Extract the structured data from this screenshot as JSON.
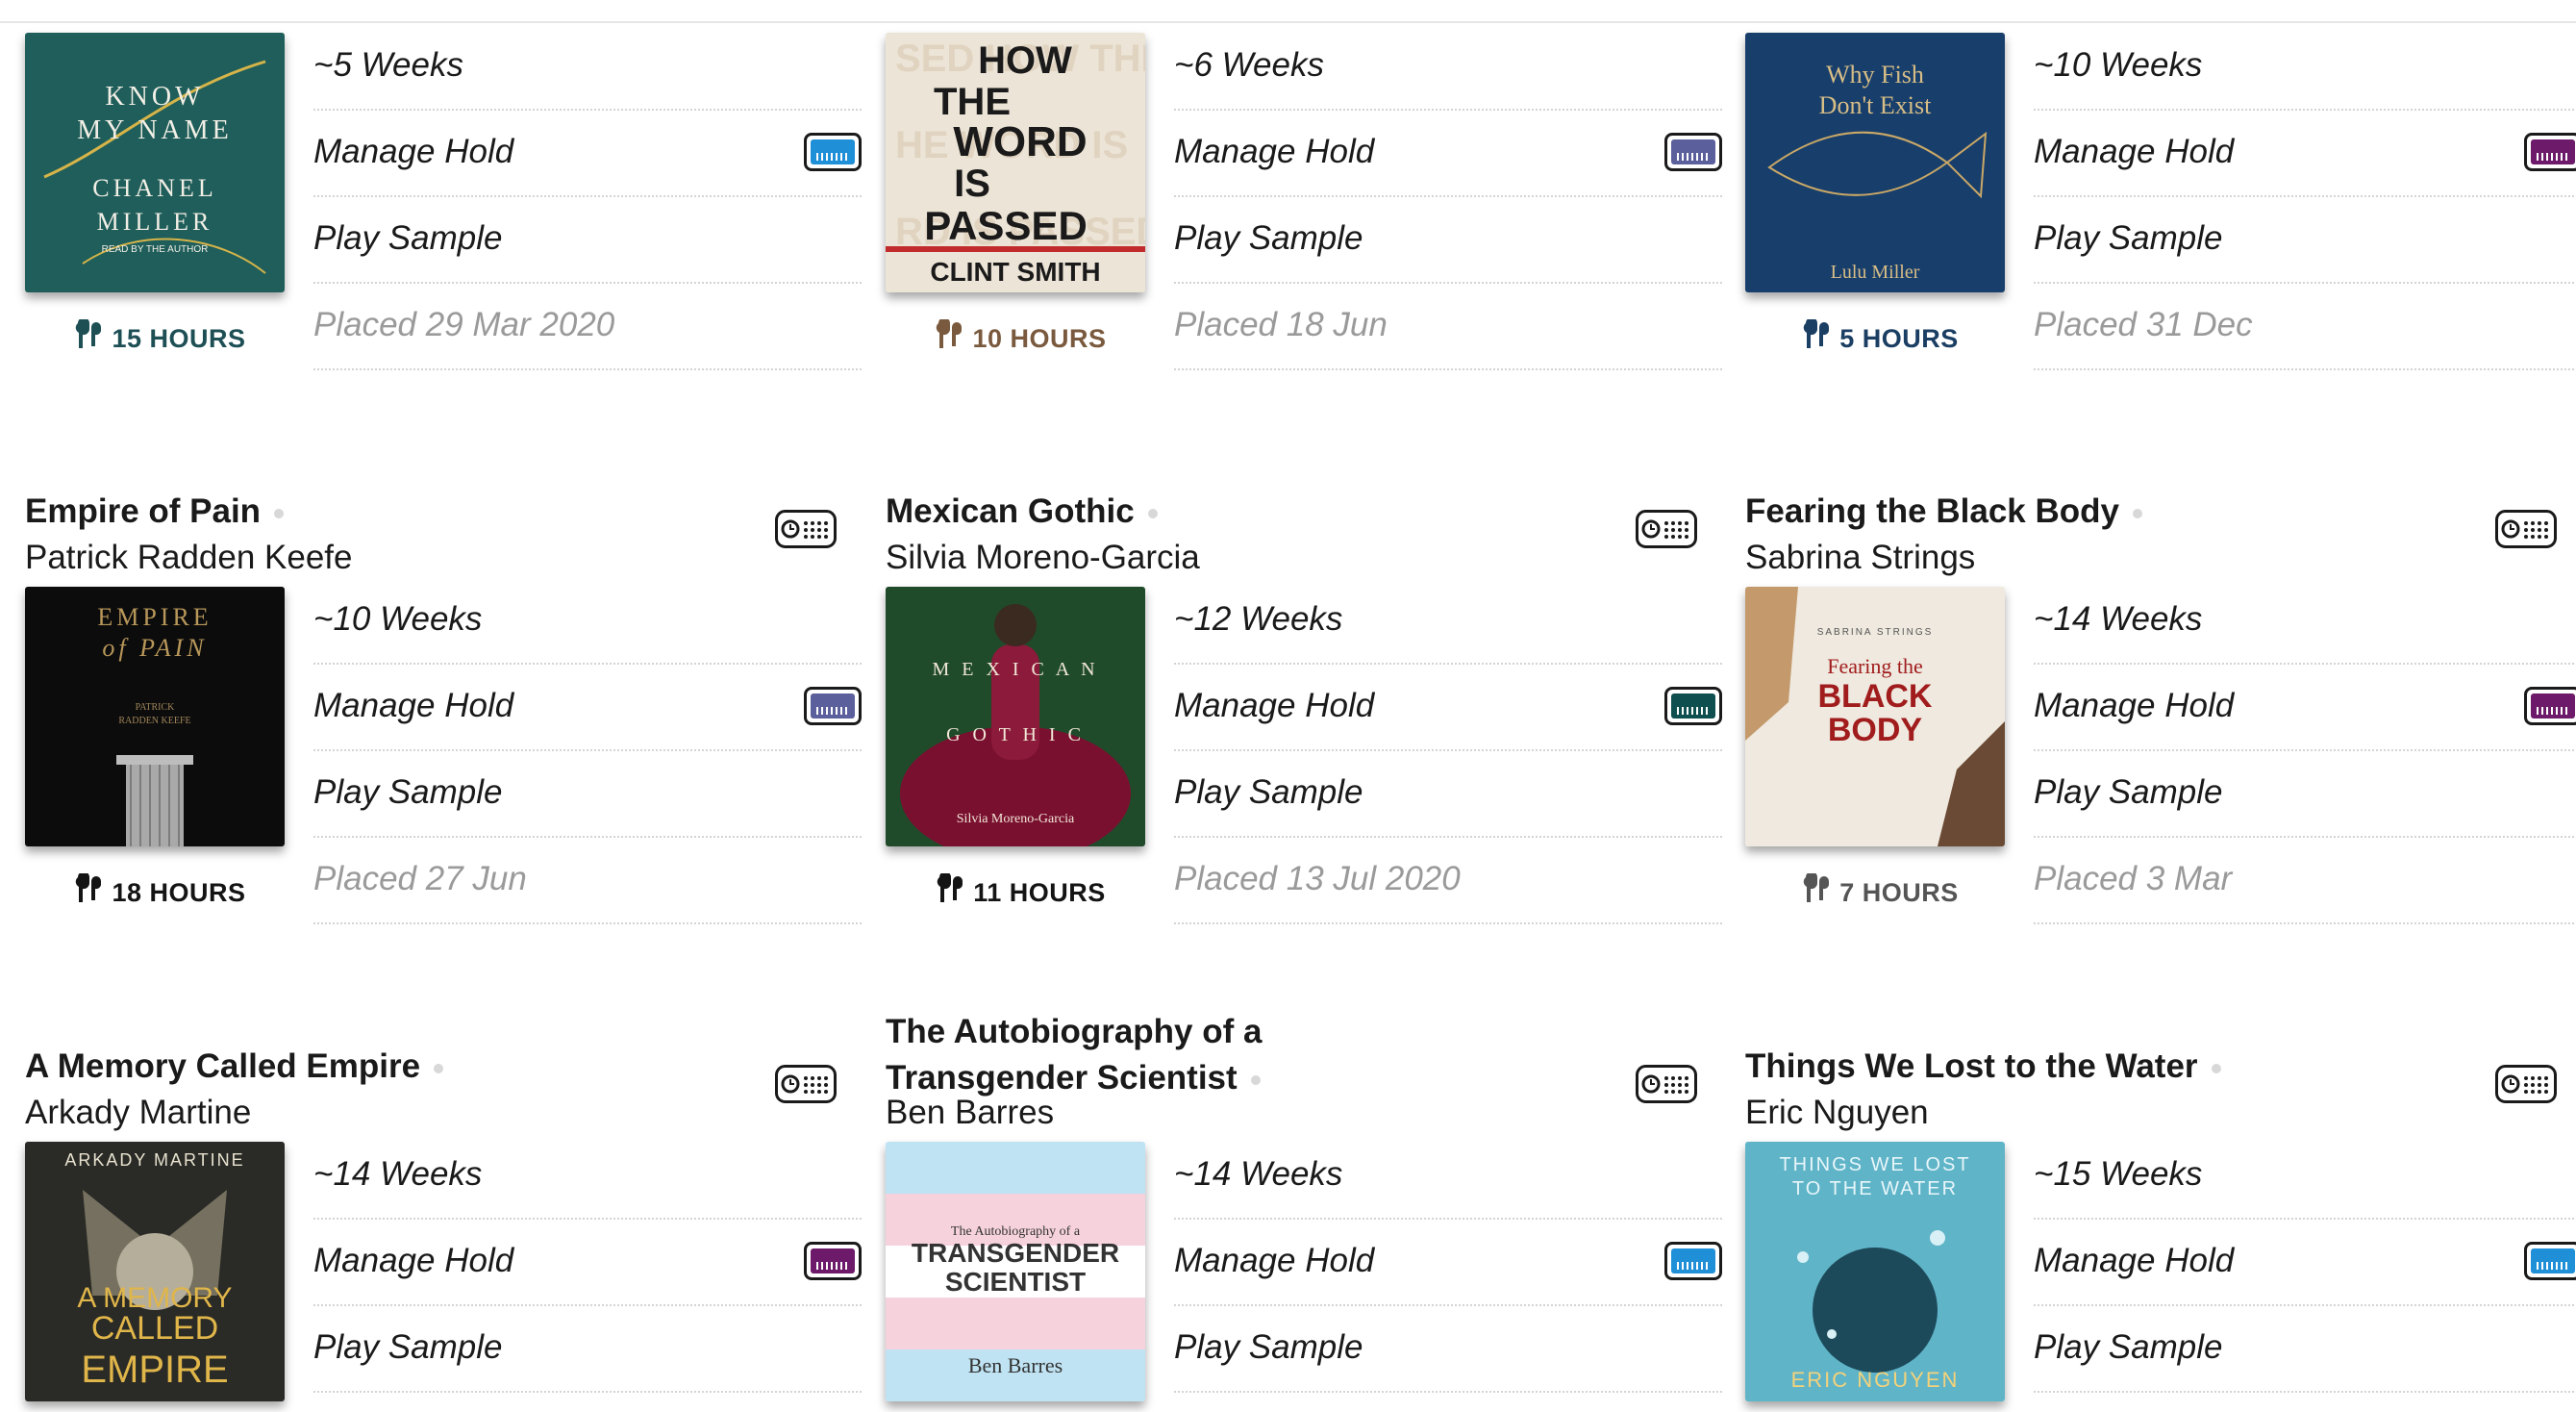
{
  "rows": [
    [
      {
        "title": "",
        "author": "",
        "weeks": "~5 Weeks",
        "manage": "Manage Hold",
        "sample": "Play Sample",
        "placed": "Placed 29 Mar 2020",
        "duration": "15 HOURS",
        "badge_color": "#1f8fd8",
        "duration_color": "#1d4f55",
        "cover": "know-my-name",
        "cover_text": [
          "KNOW",
          "MY NAME",
          "CHANEL",
          "MILLER",
          "READ BY THE AUTHOR"
        ]
      },
      {
        "title": "",
        "author": "",
        "weeks": "~6 Weeks",
        "manage": "Manage Hold",
        "sample": "Play Sample",
        "placed": "Placed 18 Jun",
        "duration": "10 HOURS",
        "badge_color": "#5b5f9c",
        "duration_color": "#7a5a3e",
        "cover": "how-the-word",
        "cover_text": [
          "HOW",
          "THE",
          "WORD",
          "IS",
          "PASSED",
          "CLINT SMITH"
        ]
      },
      {
        "title": "",
        "author": "",
        "weeks": "~10 Weeks",
        "manage": "Manage Hold",
        "sample": "Play Sample",
        "placed": "Placed 31 Dec",
        "duration": "5 HOURS",
        "badge_color": "#6d1a6a",
        "duration_color": "#1b3e63",
        "cover": "why-fish",
        "cover_text": [
          "Why Fish",
          "Don't Exist",
          "Lulu Miller"
        ]
      }
    ],
    [
      {
        "title": "Empire of Pain",
        "author": "Patrick Radden Keefe",
        "weeks": "~10 Weeks",
        "manage": "Manage Hold",
        "sample": "Play Sample",
        "placed": "Placed 27 Jun",
        "duration": "18 HOURS",
        "badge_color": "#5b5f9c",
        "duration_color": "#141414",
        "cover": "empire-of-pain",
        "cover_text": [
          "EMPIRE",
          "of PAIN",
          "PATRICK",
          "RADDEN KEEFE"
        ]
      },
      {
        "title": "Mexican Gothic",
        "author": "Silvia Moreno-Garcia",
        "weeks": "~12 Weeks",
        "manage": "Manage Hold",
        "sample": "Play Sample",
        "placed": "Placed 13 Jul 2020",
        "duration": "11 HOURS",
        "badge_color": "#0f4f4f",
        "duration_color": "#141414",
        "cover": "mexican-gothic",
        "cover_text": [
          "M E X I C A N",
          "G O T H I C",
          "Silvia Moreno-Garcia"
        ]
      },
      {
        "title": "Fearing the Black Body",
        "author": "Sabrina Strings",
        "weeks": "~14 Weeks",
        "manage": "Manage Hold",
        "sample": "Play Sample",
        "placed": "Placed 3 Mar",
        "duration": "7 HOURS",
        "badge_color": "#6d1a6a",
        "duration_color": "#555555",
        "cover": "fearing-black-body",
        "cover_text": [
          "SABRINA STRINGS",
          "Fearing the",
          "BLACK",
          "BODY"
        ]
      }
    ],
    [
      {
        "title": "A Memory Called Empire",
        "author": "Arkady Martine",
        "weeks": "~14 Weeks",
        "manage": "Manage Hold",
        "sample": "Play Sample",
        "placed": "",
        "duration": "",
        "badge_color": "#6d1a6a",
        "duration_color": "#141414",
        "cover": "memory-called-empire",
        "cover_text": [
          "ARKADY MARTINE",
          "A MEMORY",
          "CALLED",
          "EMPIRE"
        ]
      },
      {
        "title_lines": [
          "The Autobiography of a",
          "Transgender Scientist"
        ],
        "title": "",
        "author": "Ben Barres",
        "weeks": "~14 Weeks",
        "manage": "Manage Hold",
        "sample": "Play Sample",
        "placed": "",
        "duration": "",
        "badge_color": "#1f8fd8",
        "duration_color": "#141414",
        "cover": "autobiography-transgender",
        "cover_text": [
          "The Autobiography of a",
          "TRANSGENDER",
          "SCIENTIST",
          "Ben Barres"
        ]
      },
      {
        "title": "Things We Lost to the Water",
        "author": "Eric Nguyen",
        "weeks": "~15 Weeks",
        "manage": "Manage Hold",
        "sample": "Play Sample",
        "placed": "",
        "duration": "",
        "badge_color": "#1f8fd8",
        "duration_color": "#141414",
        "cover": "things-we-lost",
        "cover_text": [
          "THINGS WE LOST",
          "TO THE WATER",
          "ERIC NGUYEN"
        ]
      }
    ]
  ]
}
